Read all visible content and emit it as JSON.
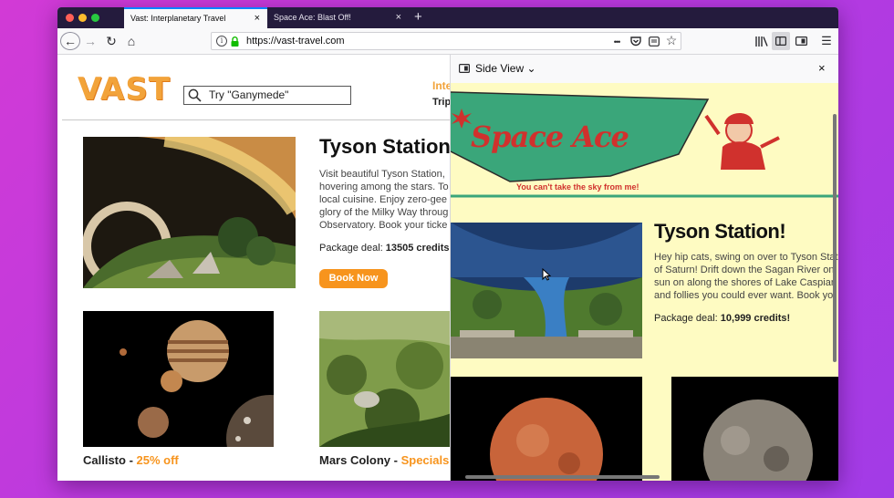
{
  "tabs": [
    {
      "title": "Vast: Interplanetary Travel",
      "active": true
    },
    {
      "title": "Space Ace: Blast Off!",
      "active": false
    }
  ],
  "new_tab_label": "+",
  "close_glyph": "×",
  "url": "https://vast-travel.com",
  "toolbar_icons": {
    "back": "←",
    "forward": "→",
    "reload": "↻",
    "home": "⌂",
    "page_actions": "•••",
    "pocket": "⬡",
    "reader": "▣",
    "bookmark": "☆",
    "library": "|||\\",
    "sidebar": "◫",
    "screenshots": "▣",
    "menu": "☰"
  },
  "vast": {
    "logo": "VAST",
    "search_placeholder": "Try \"Ganymede\"",
    "nav_primary": "Inte",
    "nav_secondary": "Trip",
    "feature": {
      "title": "Tyson Station",
      "description_lines": [
        "Visit beautiful Tyson Station,",
        "hovering among the stars. To",
        "local cuisine. Enjoy zero-gee",
        "glory of the Milky Way throug",
        "Observatory. Book your ticke"
      ],
      "package_label": "Package deal: ",
      "package_value": "13505 credits",
      "book_button": "Book Now"
    },
    "cards": [
      {
        "name": "Callisto",
        "sep": " - ",
        "tag": "25% off"
      },
      {
        "name": "Mars Colony",
        "sep": " - ",
        "tag": "Specials"
      }
    ]
  },
  "side_view": {
    "header_title": "Side View",
    "chevron": "⌄",
    "logo_text": "Space Ace",
    "tagline": "You can't take the sky from me!",
    "feature": {
      "title": "Tyson Station!",
      "description_lines": [
        "Hey hip cats, swing on over to Tyson Stat",
        "of Saturn! Drift down the Sagan River on",
        "sun on along the shores of Lake Caspian",
        "and follies you could ever want. Book yo"
      ],
      "package_label": "Package deal: ",
      "package_value": "10,999 credits!"
    }
  },
  "colors": {
    "accent_orange": "#f7941d",
    "vast_logo": "#f2a33a",
    "side_bg": "#fefbc2",
    "space_ace_green": "#3aa67a",
    "space_ace_red": "#d0312d",
    "active_tab_line": "#0a84ff"
  }
}
